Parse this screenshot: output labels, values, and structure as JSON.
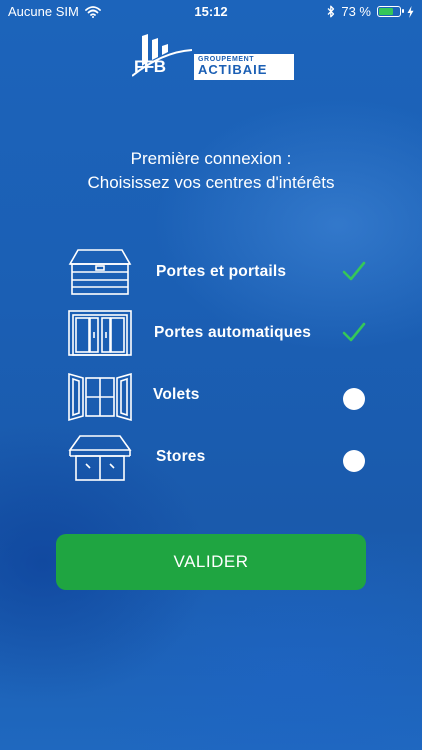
{
  "status_bar": {
    "carrier": "Aucune SIM",
    "time": "15:12",
    "battery_percent_label": "73 %",
    "battery_level": 0.73,
    "battery_color": "#35c759"
  },
  "logo": {
    "ffb": "FFB",
    "group_label": "GROUPEMENT",
    "brand": "ACTIBAIE"
  },
  "heading": {
    "line1": "Première connexion :",
    "line2": "Choisissez vos centres d'intérêts"
  },
  "interests": [
    {
      "label": "Portes et portails",
      "selected": true,
      "icon": "garage-door-icon"
    },
    {
      "label": "Portes automatiques",
      "selected": true,
      "icon": "automatic-door-icon"
    },
    {
      "label": "Volets",
      "selected": false,
      "icon": "shutters-icon"
    },
    {
      "label": "Stores",
      "selected": false,
      "icon": "awning-icon"
    }
  ],
  "colors": {
    "accent_green": "#1fa541",
    "check_green": "#35c759",
    "background_blue": "#1b5fb4"
  },
  "validate_button": {
    "label": "VALIDER"
  }
}
